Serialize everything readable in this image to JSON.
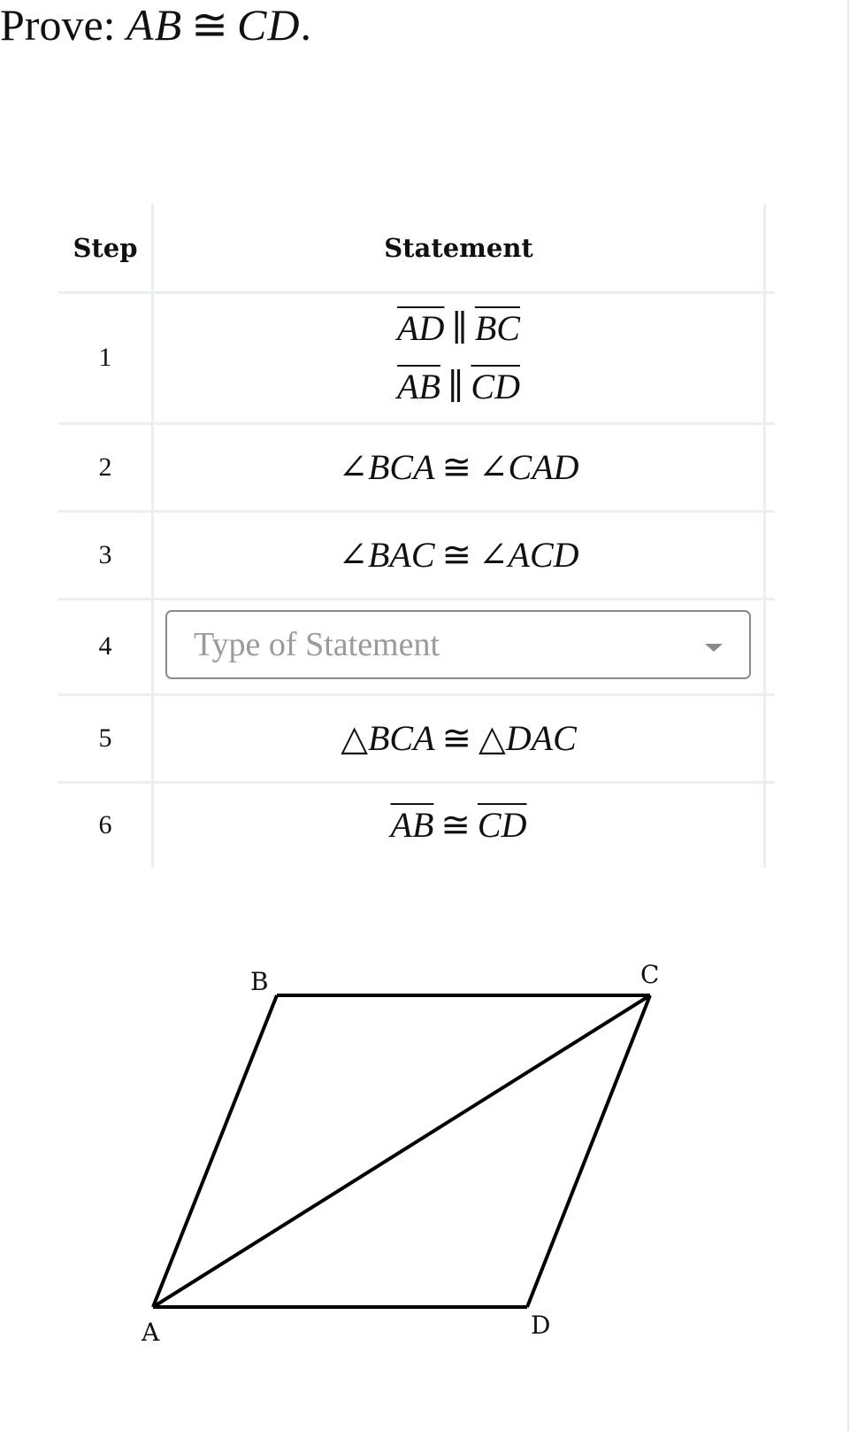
{
  "prompt": {
    "label": "Prove:",
    "left": "AB",
    "relation": "≅",
    "right": "CD",
    "end": "."
  },
  "table": {
    "headers": {
      "step": "Step",
      "statement": "Statement"
    },
    "rows": [
      {
        "step": "1",
        "lines": [
          {
            "left": "AD",
            "rel": "∥",
            "right": "BC",
            "overline": true
          },
          {
            "left": "AB",
            "rel": "∥",
            "right": "CD",
            "overline": true
          }
        ]
      },
      {
        "step": "2",
        "lines": [
          {
            "left": "∠BCA",
            "rel": "≅",
            "right": "∠CAD",
            "overline": false
          }
        ]
      },
      {
        "step": "3",
        "lines": [
          {
            "left": "∠BAC",
            "rel": "≅",
            "right": "∠ACD",
            "overline": false
          }
        ]
      },
      {
        "step": "4",
        "select": {
          "placeholder": "Type of Statement",
          "value": ""
        }
      },
      {
        "step": "5",
        "lines": [
          {
            "left": "△BCA",
            "rel": "≅",
            "right": "△DAC",
            "overline": false
          }
        ]
      },
      {
        "step": "6",
        "lines": [
          {
            "left": "AB",
            "rel": "≅",
            "right": "CD",
            "overline": true
          }
        ]
      }
    ]
  },
  "diagram": {
    "shape": "parallelogram ABCD with diagonal AC",
    "vertices": [
      "A",
      "B",
      "C",
      "D"
    ],
    "segments": [
      "AB",
      "BC",
      "CD",
      "DA",
      "AC"
    ],
    "labels": {
      "A": "A",
      "B": "B",
      "C": "C",
      "D": "D"
    },
    "stroke_color": "#000000"
  }
}
